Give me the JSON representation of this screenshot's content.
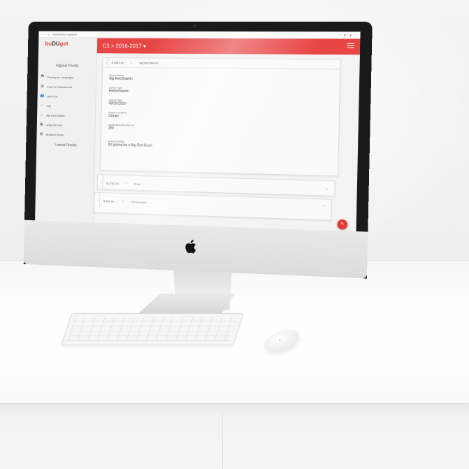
{
  "browser": {
    "url": "brandheech.appspot",
    "nav_glyphs": "←  →  C",
    "ext_icons": [
      "☆",
      "◧",
      "●",
      "⋮"
    ]
  },
  "app": {
    "logo_a": "bu",
    "logo_b": "DU",
    "logo_c": "get",
    "header_title": "C3 > 2016-2017 ▾",
    "accent": "#e84545"
  },
  "sidebar": {
    "highest_label": "Highest Priority",
    "lowest_label": "Lowest Priority",
    "items": [
      {
        "icon": "printer-icon",
        "glyph": "🖶",
        "label": "Printing for Campaigns"
      },
      {
        "icon": "document-icon",
        "glyph": "▤",
        "label": "Fees for Outreachers"
      },
      {
        "icon": "people-icon",
        "glyph": "👥",
        "label": "Jam Fest"
      },
      {
        "icon": "stairs-icon",
        "glyph": "⌐",
        "label": "Fall"
      },
      {
        "icon": "music-icon",
        "glyph": "♪",
        "label": "Big Red Bashin"
      },
      {
        "icon": "calendar-icon",
        "glyph": "▣",
        "label": "A Big Ol' Fest"
      },
      {
        "icon": "document-icon",
        "glyph": "▤",
        "label": "Bradical Dinner"
      }
    ]
  },
  "cards": {
    "expanded": {
      "amount": "$ 3061.00",
      "name": "Big Red Bashin",
      "fields": [
        {
          "label": "Event Name",
          "value": "Big Red Bashin"
        },
        {
          "label": "Event Type",
          "value": "Performance"
        },
        {
          "label": "Event Date",
          "value": "08/25/2016"
        },
        {
          "label": "Event Location",
          "value": "Library"
        },
        {
          "label": "Expected Attendance",
          "value": "250"
        },
        {
          "label": "Event Details",
          "value": "It's gonna be a Big Red Bash."
        }
      ]
    },
    "collapsed": [
      {
        "amount": "$ 2761.33",
        "name": "Food",
        "chevron": "⌄"
      },
      {
        "amount": "$ 300.00",
        "name": "Performance",
        "chevron": "⌃"
      }
    ]
  },
  "fab": "✎"
}
